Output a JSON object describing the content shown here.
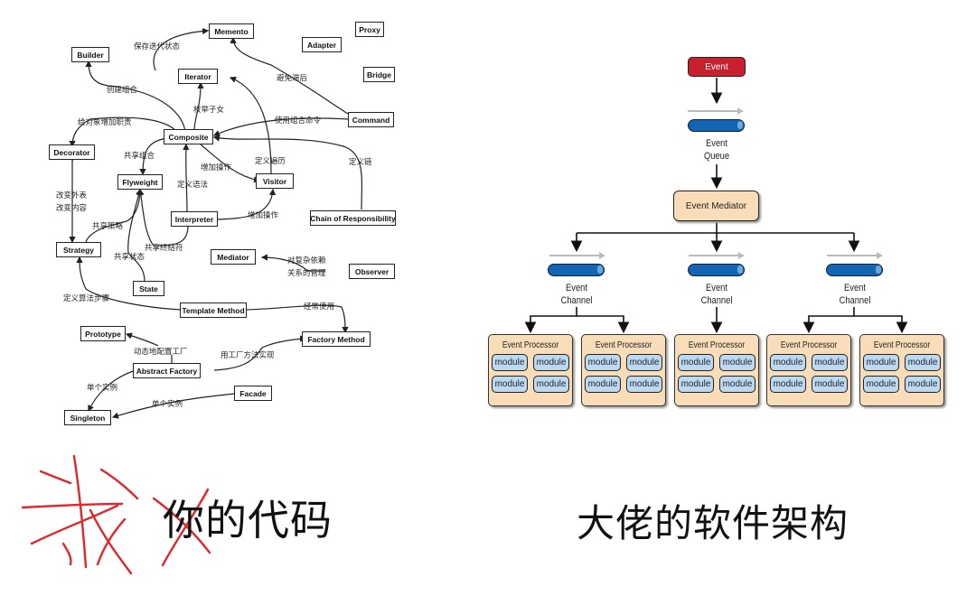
{
  "left": {
    "caption_struck": "我",
    "caption_text": "你的代码",
    "patterns": {
      "memento": "Memento",
      "proxy": "Proxy",
      "adapter": "Adapter",
      "builder": "Builder",
      "iterator": "Iterator",
      "bridge": "Bridge",
      "command": "Command",
      "composite": "Composite",
      "decorator": "Decorator",
      "flyweight": "Flyweight",
      "visitor": "Visitor",
      "interpreter": "Interpreter",
      "chain": "Chain of Responsibility",
      "strategy": "Strategy",
      "mediator": "Mediator",
      "observer": "Observer",
      "state": "State",
      "template": "Template Method",
      "prototype": "Prototype",
      "factory_method": "Factory Method",
      "abstract_factory": "Abstract Factory",
      "facade": "Facade",
      "singleton": "Singleton"
    },
    "labels": {
      "save_iter_state": "保存迭代状态",
      "avoid_lag": "避免滞后",
      "create_composite": "创建组合",
      "enumerate_children": "枚举子女",
      "use_composite_cmd": "使用组合命令",
      "add_duties": "给对象增加职责",
      "share_composite": "共享组合",
      "define_traversal": "定义遍历",
      "define_chain": "定义链",
      "add_ops_1": "增加操作",
      "define_grammar": "定义语法",
      "change_skin": "改变外表",
      "change_guts": "改变内容",
      "share_strategy": "共享策略",
      "add_ops_2": "增加操作",
      "share_terminals": "共享终结符",
      "share_state": "共享状态",
      "complex_deps_1": "对复杂依赖",
      "complex_deps_2": "关系的管理",
      "define_algo_steps": "定义算法步骤",
      "often_uses": "经常使用",
      "configure_factory": "动态地配置工厂",
      "impl_with_factory_method": "用工厂方法实现",
      "single_instance_1": "单个实例",
      "single_instance_2": "单个实例"
    }
  },
  "right": {
    "caption": "大佬的软件架构",
    "event": "Event",
    "queue_label": [
      "Event",
      "Queue"
    ],
    "mediator": "Event Mediator",
    "channel_label": [
      "Event",
      "Channel"
    ],
    "processor_title": "Event Processor",
    "module_label": "module",
    "colors": {
      "event": "#c8202f",
      "mediator": "#f9dcb8",
      "pipe": "#1464b4",
      "module": "#bcd9ef"
    }
  }
}
